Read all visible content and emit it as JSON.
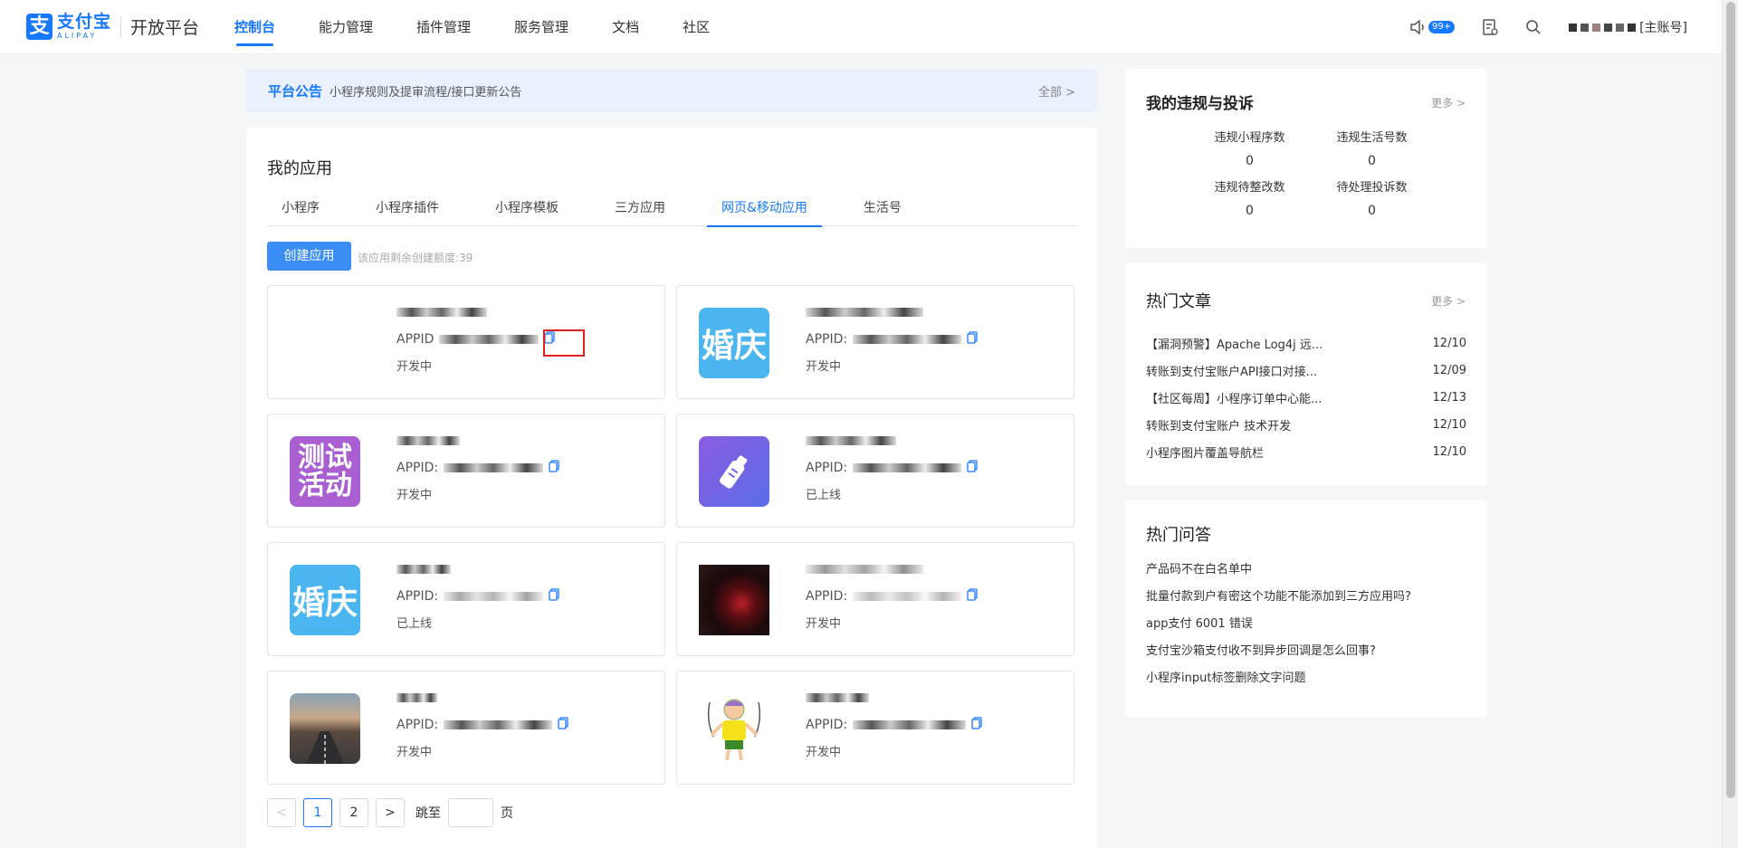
{
  "brand": {
    "logo_cn": "支付宝",
    "logo_en": "ALIPAY",
    "platform": "开放平台",
    "accent": "#1677ff"
  },
  "nav": {
    "items": [
      {
        "label": "控制台",
        "active": true
      },
      {
        "label": "能力管理"
      },
      {
        "label": "插件管理"
      },
      {
        "label": "服务管理"
      },
      {
        "label": "文档"
      },
      {
        "label": "社区"
      }
    ],
    "badge": "99+",
    "account_suffix": "[主账号]"
  },
  "announcement": {
    "title": "平台公告",
    "text": "小程序规则及提审流程/接口更新公告",
    "all": "全部 >"
  },
  "apps_section": {
    "title": "我的应用",
    "tabs": [
      {
        "label": "小程序"
      },
      {
        "label": "小程序插件"
      },
      {
        "label": "小程序模板"
      },
      {
        "label": "三方应用"
      },
      {
        "label": "网页&移动应用",
        "active": true
      },
      {
        "label": "生活号"
      }
    ],
    "create_button": "创建应用",
    "quota": "该应用剩余创建额度:39",
    "apps": [
      {
        "appid_label": "APPID",
        "status": "开发中",
        "icon": "none"
      },
      {
        "appid_label": "APPID:",
        "status": "开发中",
        "icon": "wedding",
        "icon_text": "婚庆"
      },
      {
        "appid_label": "APPID:",
        "status": "开发中",
        "icon": "test",
        "icon_text": "测试活动"
      },
      {
        "appid_label": "APPID:",
        "status": "已上线",
        "icon": "bottle"
      },
      {
        "appid_label": "APPID:",
        "status": "已上线",
        "icon": "wedding",
        "icon_text": "婚庆"
      },
      {
        "appid_label": "APPID:",
        "status": "开发中",
        "icon": "lips"
      },
      {
        "appid_label": "APPID:",
        "status": "开发中",
        "icon": "road"
      },
      {
        "appid_label": "APPID:",
        "status": "开发中",
        "icon": "cartoon"
      }
    ],
    "pager": {
      "prev": "<",
      "pages": [
        "1",
        "2"
      ],
      "next": ">",
      "jump_label": "跳至",
      "page_label": "页"
    }
  },
  "violations": {
    "title": "我的违规与投诉",
    "more": "更多 >",
    "stats": [
      {
        "label": "违规小程序数",
        "value": "0"
      },
      {
        "label": "违规生活号数",
        "value": "0"
      },
      {
        "label": "违规待整改数",
        "value": "0"
      },
      {
        "label": "待处理投诉数",
        "value": "0"
      }
    ]
  },
  "hot_articles": {
    "title": "热门文章",
    "more": "更多 >",
    "items": [
      {
        "title": "【漏洞预警】Apache Log4j 远...",
        "date": "12/10"
      },
      {
        "title": "转账到支付宝账户API接口对接...",
        "date": "12/09"
      },
      {
        "title": "【社区每周】小程序订单中心能...",
        "date": "12/13"
      },
      {
        "title": "转账到支付宝账户 技术开发",
        "date": "12/10"
      },
      {
        "title": "小程序图片覆盖导航栏",
        "date": "12/10"
      }
    ]
  },
  "hot_qa": {
    "title": "热门问答",
    "items": [
      "产品码不在白名单中",
      "批量付款到户有密这个功能不能添加到三方应用吗?",
      "app支付 6001 错误",
      "支付宝沙箱支付收不到异步回调是怎么回事?",
      "小程序input标签删除文字问题"
    ]
  }
}
